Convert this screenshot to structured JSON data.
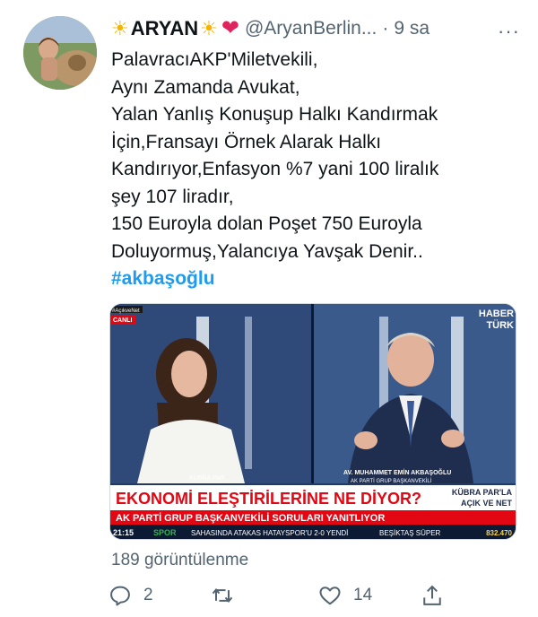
{
  "header": {
    "display_name": "ARYAN",
    "handle": "@AryanBerlin...",
    "separator": "·",
    "time": "9 sa",
    "more_label": "···"
  },
  "tweet": {
    "lines": [
      "PalavracıAKP'Miletvekili,",
      "Aynı Zamanda Avukat,",
      "Yalan Yanlış Konuşup Halkı Kandırmak",
      "İçin,Fransayı Örnek Alarak Halkı",
      "Kandırıyor,Enfasyon %7 yani 100 liralık",
      "şey 107 liradır,",
      "150 Euroyla dolan Poşet 750 Euroyla",
      "Doluyormuş,Yalancıya Yavşak Denir.."
    ],
    "hashtag": "#akbaşoğlu"
  },
  "media": {
    "badge_top": "#AçıkveNet",
    "live": "CANLI",
    "channel_line1": "HABER",
    "channel_line2": "TÜRK",
    "guest_left_name": "KÜBRA PAR",
    "guest_right_name": "AV. MUHAMMET EMİN AKBAŞOĞLU",
    "guest_right_title": "AK PARTİ GRUP BAŞKANVEKİLİ",
    "headline": "EKONOMİ ELEŞTİRİLERİNE NE DİYOR?",
    "show_line1": "KÜBRA PAR'LA",
    "show_line2": "AÇIK VE NET",
    "subheadline": "AK PARTİ GRUP BAŞKANVEKİLİ SORULARI YANITLIYOR",
    "ticker_time": "21:15",
    "ticker_category": "SPOR",
    "ticker_text": "SAHASINDA ATAKAS HATAYSPOR'U 2-0 YENDİ",
    "ticker_right": "BEŞİKTAŞ SÜPER",
    "ticker_index": "832.470"
  },
  "views": "189 görüntülenme",
  "actions": {
    "reply_count": "2",
    "retweet_count": "",
    "like_count": "14"
  },
  "colors": {
    "link": "#1d9bf0",
    "secondary_text": "#536471",
    "headline_red": "#e30613",
    "heart": "#e0245e"
  }
}
